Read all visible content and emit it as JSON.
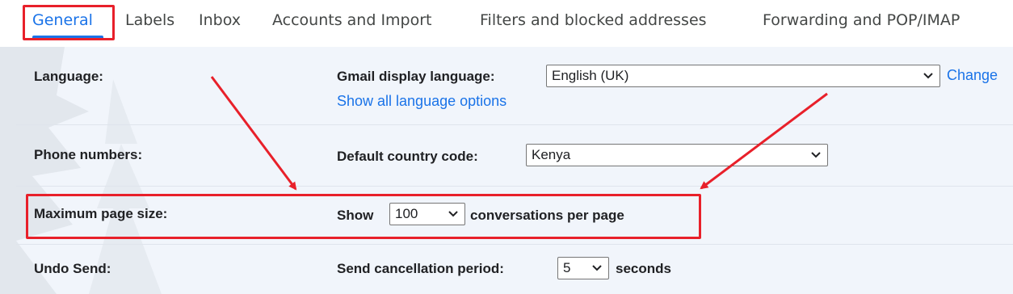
{
  "tabs": [
    {
      "label": "General",
      "active": true
    },
    {
      "label": "Labels",
      "active": false
    },
    {
      "label": "Inbox",
      "active": false
    },
    {
      "label": "Accounts and Import",
      "active": false
    },
    {
      "label": "Filters and blocked addresses",
      "active": false
    },
    {
      "label": "Forwarding and POP/IMAP",
      "active": false
    }
  ],
  "settings": {
    "language": {
      "label": "Language:",
      "field_label": "Gmail display language:",
      "value": "English (UK)",
      "change_link": "Change",
      "show_all_link": "Show all language options"
    },
    "phone": {
      "label": "Phone numbers:",
      "field_label": "Default country code:",
      "value": "Kenya"
    },
    "page_size": {
      "label": "Maximum page size:",
      "prefix": "Show",
      "value": "100",
      "suffix": "conversations per page"
    },
    "undo_send": {
      "label": "Undo Send:",
      "field_label": "Send cancellation period:",
      "value": "5",
      "suffix": "seconds"
    }
  },
  "colors": {
    "accent": "#1a73e8",
    "annotation": "#e8202a",
    "background": "#f1f5fb"
  }
}
